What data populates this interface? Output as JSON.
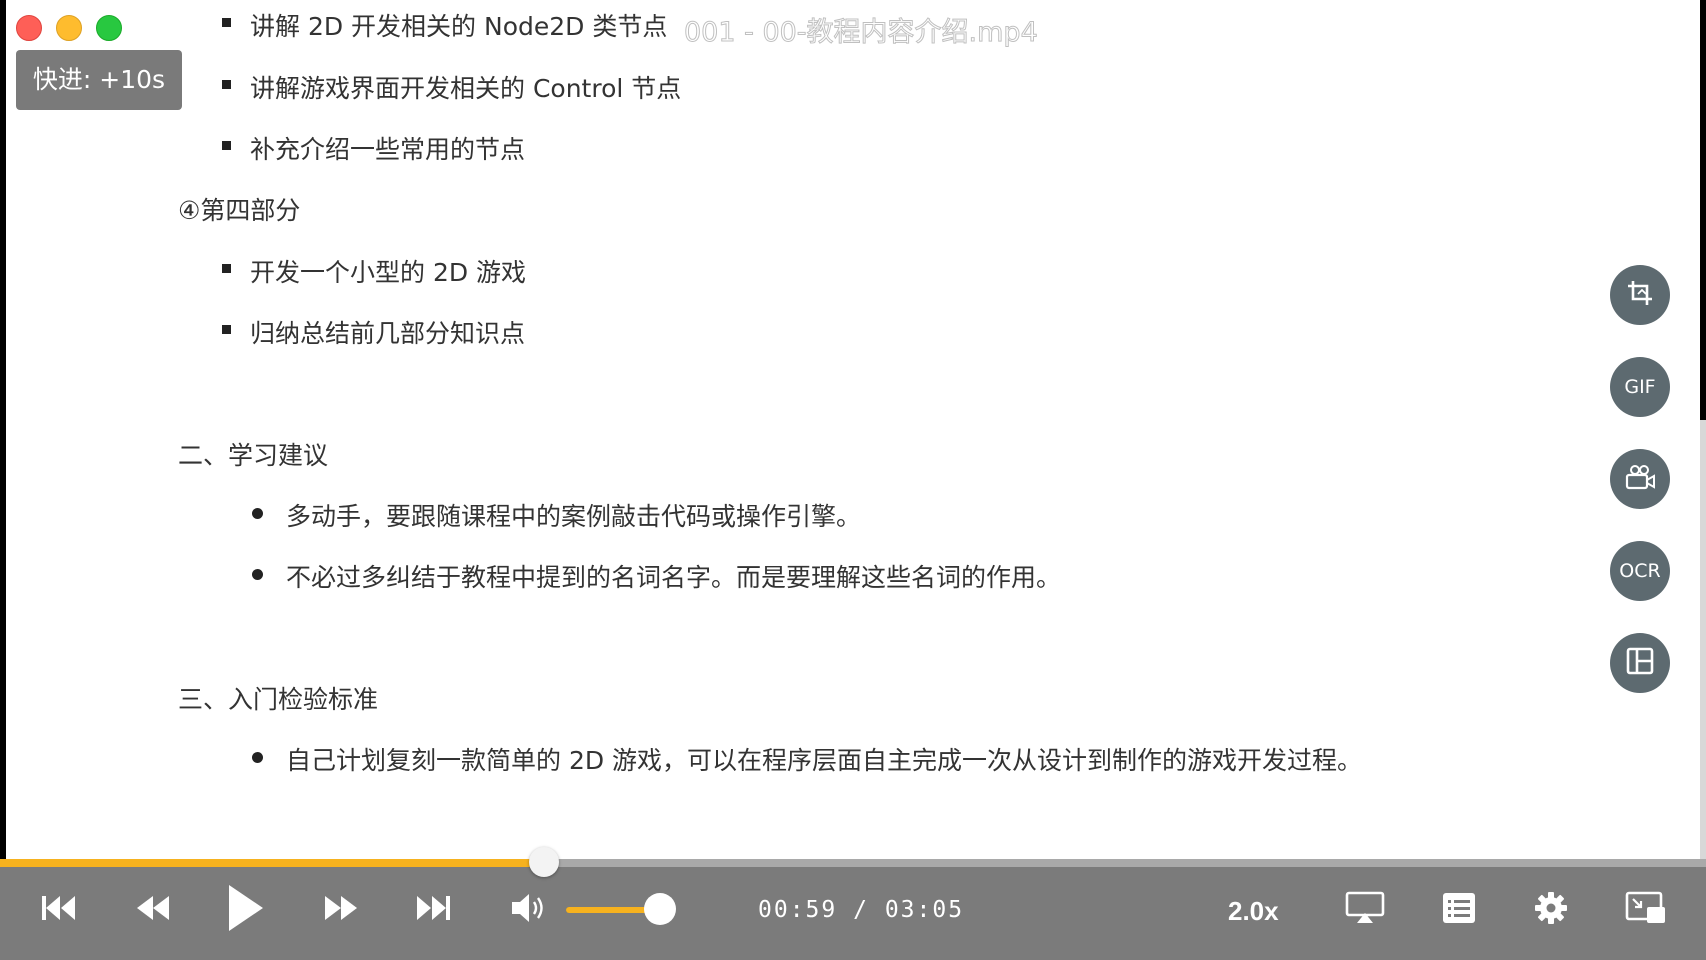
{
  "window": {
    "video_title": "001 - 00-教程内容介绍.mp4",
    "osd_toast": "快进: +10s"
  },
  "slide": {
    "section4_items_top": [
      "讲解 2D 开发相关的 Node2D 类节点",
      "讲解游戏界面开发相关的 Control 节点",
      "补充介绍一些常用的节点"
    ],
    "section4_heading": "④第四部分",
    "section4_items": [
      "开发一个小型的 2D 游戏",
      "归纳总结前几部分知识点"
    ],
    "learning_heading": "二、学习建议",
    "learning_items": [
      "多动手，要跟随课程中的案例敲击代码或操作引擎。",
      "不必过多纠结于教程中提到的名词名字。而是要理解这些名词的作用。"
    ],
    "criteria_heading": "三、入门检验标准",
    "criteria_items": [
      "自己计划复刻一款简单的 2D 游戏，可以在程序层面自主完成一次从设计到制作的游戏开发过程。"
    ]
  },
  "side_tools": [
    {
      "label": "",
      "icon": "crop-icon"
    },
    {
      "label": "GIF",
      "icon": "gif-icon"
    },
    {
      "label": "",
      "icon": "video-camera-icon"
    },
    {
      "label": "OCR",
      "icon": "ocr-icon"
    },
    {
      "label": "",
      "icon": "layout-icon"
    }
  ],
  "player": {
    "current_time": "00:59",
    "separator": "/",
    "duration": "03:05",
    "speed": "2.0x",
    "progress_fraction": 0.319,
    "volume_fraction": 0.9,
    "accent_color": "#f6b21f"
  }
}
